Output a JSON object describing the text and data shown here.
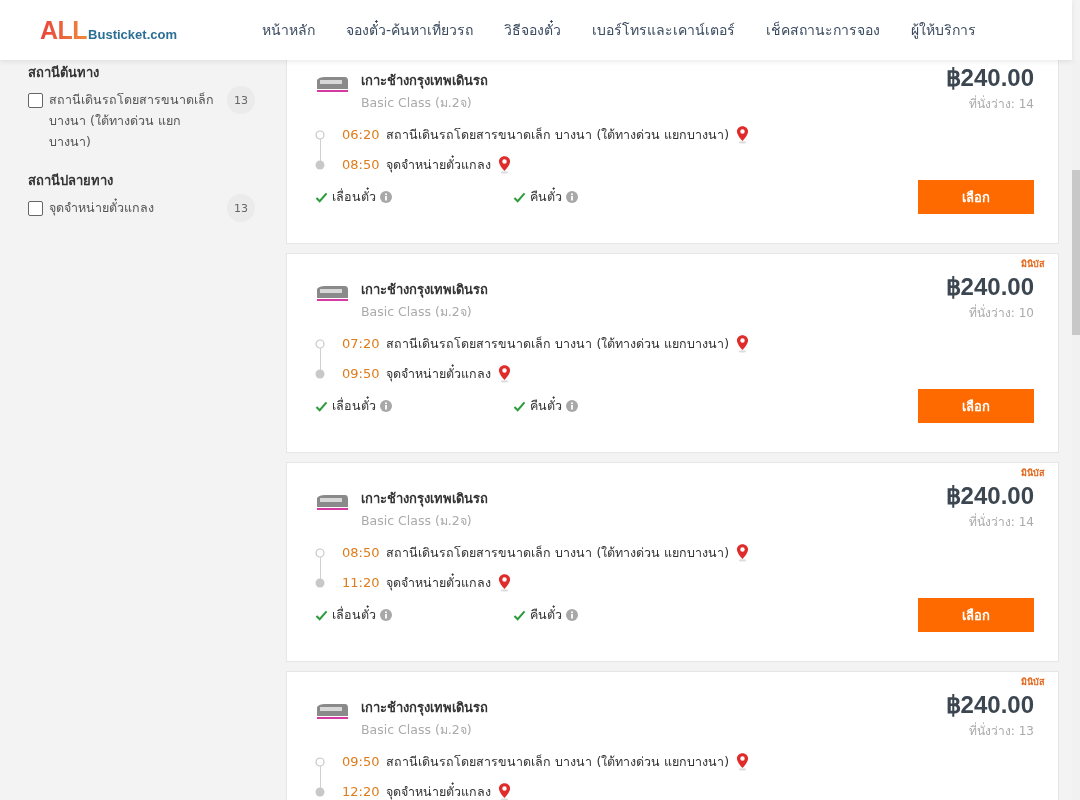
{
  "logo": {
    "brand": "ALL",
    "domain": "Busticket.com"
  },
  "nav": [
    {
      "label": "หน้าหลัก"
    },
    {
      "label": "จองตั๋ว-ค้นหาเที่ยวรถ"
    },
    {
      "label": "วิธีจองตั๋ว"
    },
    {
      "label": "เบอร์โทรและเคาน์เตอร์"
    },
    {
      "label": "เช็คสถานะการจอง"
    },
    {
      "label": "ผู้ให้บริการ"
    }
  ],
  "filters": [
    {
      "heading": "สถานีต้นทาง",
      "options": [
        {
          "label": "สถานีเดินรถโดยสารขนาดเล็ก บางนา (ใต้ทางด่วน แยกบางนา)",
          "count": "13",
          "checked": false
        }
      ]
    },
    {
      "heading": "สถานีปลายทาง",
      "options": [
        {
          "label": "จุดจำหน่ายตั๋วแกลง",
          "count": "13",
          "checked": false
        }
      ]
    }
  ],
  "trips": [
    {
      "operator": "เกาะช้างกรุงเทพเดินรถ",
      "class": "Basic Class (ม.2จ)",
      "price": "฿240.00",
      "seats": "ที่นั่งว่าง: 14",
      "stops": [
        {
          "time": "06:20",
          "place": "สถานีเดินรถโดยสารขนาดเล็ก บางนา (ใต้ทางด่วน แยกบางนา)"
        },
        {
          "time": "08:50",
          "place": "จุดจำหน่ายตั๋วแกลง"
        }
      ],
      "features": [
        {
          "label": "เลื่อนตั๋ว",
          "available": true
        },
        {
          "label": "คืนตั๋ว",
          "available": true
        }
      ],
      "button": "เลือก"
    },
    {
      "tag": "มินิบัส",
      "operator": "เกาะช้างกรุงเทพเดินรถ",
      "class": "Basic Class (ม.2จ)",
      "price": "฿240.00",
      "seats": "ที่นั่งว่าง: 10",
      "stops": [
        {
          "time": "07:20",
          "place": "สถานีเดินรถโดยสารขนาดเล็ก บางนา (ใต้ทางด่วน แยกบางนา)"
        },
        {
          "time": "09:50",
          "place": "จุดจำหน่ายตั๋วแกลง"
        }
      ],
      "features": [
        {
          "label": "เลื่อนตั๋ว",
          "available": true
        },
        {
          "label": "คืนตั๋ว",
          "available": true
        }
      ],
      "button": "เลือก"
    },
    {
      "tag": "มินิบัส",
      "operator": "เกาะช้างกรุงเทพเดินรถ",
      "class": "Basic Class (ม.2จ)",
      "price": "฿240.00",
      "seats": "ที่นั่งว่าง: 14",
      "stops": [
        {
          "time": "08:50",
          "place": "สถานีเดินรถโดยสารขนาดเล็ก บางนา (ใต้ทางด่วน แยกบางนา)"
        },
        {
          "time": "11:20",
          "place": "จุดจำหน่ายตั๋วแกลง"
        }
      ],
      "features": [
        {
          "label": "เลื่อนตั๋ว",
          "available": true
        },
        {
          "label": "คืนตั๋ว",
          "available": true
        }
      ],
      "button": "เลือก"
    },
    {
      "tag": "มินิบัส",
      "operator": "เกาะช้างกรุงเทพเดินรถ",
      "class": "Basic Class (ม.2จ)",
      "price": "฿240.00",
      "seats": "ที่นั่งว่าง: 13",
      "stops": [
        {
          "time": "09:50",
          "place": "สถานีเดินรถโดยสารขนาดเล็ก บางนา (ใต้ทางด่วน แยกบางนา)"
        },
        {
          "time": "12:20",
          "place": "จุดจำหน่ายตั๋วแกลง"
        }
      ]
    }
  ]
}
